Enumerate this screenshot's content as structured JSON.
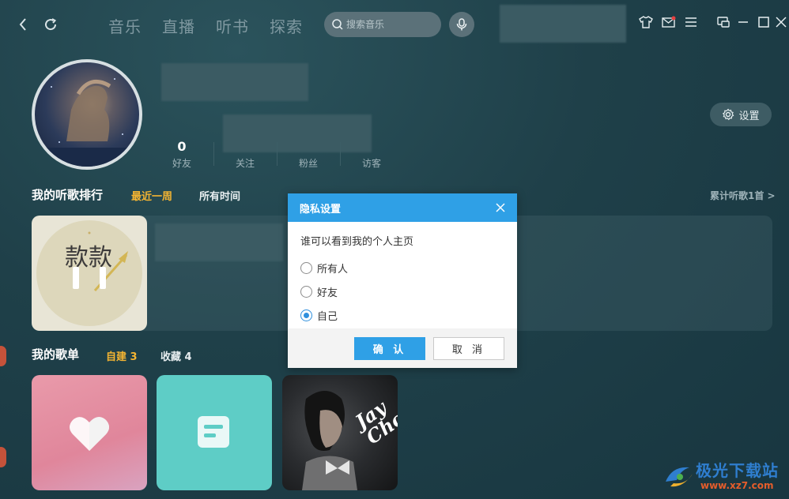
{
  "nav": {
    "tabs": [
      "音乐",
      "直播",
      "听书",
      "探索"
    ]
  },
  "search": {
    "placeholder": "搜索音乐"
  },
  "profile": {
    "settings_label": "设置",
    "stats": [
      {
        "num": "0",
        "label": "好友"
      },
      {
        "num": "",
        "label": "关注"
      },
      {
        "num": "",
        "label": "粉丝"
      },
      {
        "num": "",
        "label": "访客"
      }
    ]
  },
  "ranking": {
    "title": "我的听歌排行",
    "tab_recent": "最近一周",
    "tab_all": "所有时间",
    "total_link": "累计听歌1首 >",
    "cover_text": "款款"
  },
  "playlists": {
    "title": "我的歌单",
    "tab_created": "自建 3",
    "tab_collected": "收藏 4",
    "album_text": "Jay Chou"
  },
  "dialog": {
    "title": "隐私设置",
    "question": "谁可以看到我的个人主页",
    "options": [
      "所有人",
      "好友",
      "自己"
    ],
    "selected": 2,
    "confirm": "确 认",
    "cancel": "取 消"
  },
  "watermark": {
    "name": "极光下载站",
    "url": "www.xz7.com"
  },
  "colors": {
    "accent": "#f5b532",
    "dialog_header": "#2fa0e6",
    "background": "#1e3f47"
  }
}
